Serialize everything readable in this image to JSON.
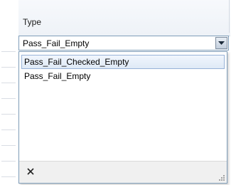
{
  "grid": {
    "column_header": "Type"
  },
  "type_combo": {
    "value": "Pass_Fail_Empty"
  },
  "dropdown": {
    "options": [
      {
        "label": "Pass_Fail_Checked_Empty",
        "highlighted": true
      },
      {
        "label": "Pass_Fail_Empty",
        "highlighted": false
      }
    ],
    "clear_icon": "close-icon",
    "resize_icon": "resize-grip-icon"
  },
  "colors": {
    "combo_border": "#7f9db9",
    "highlight_border": "#98b3d8",
    "highlight_fill": "#dfe9f6",
    "footer_bg": "#f0f0f0"
  }
}
